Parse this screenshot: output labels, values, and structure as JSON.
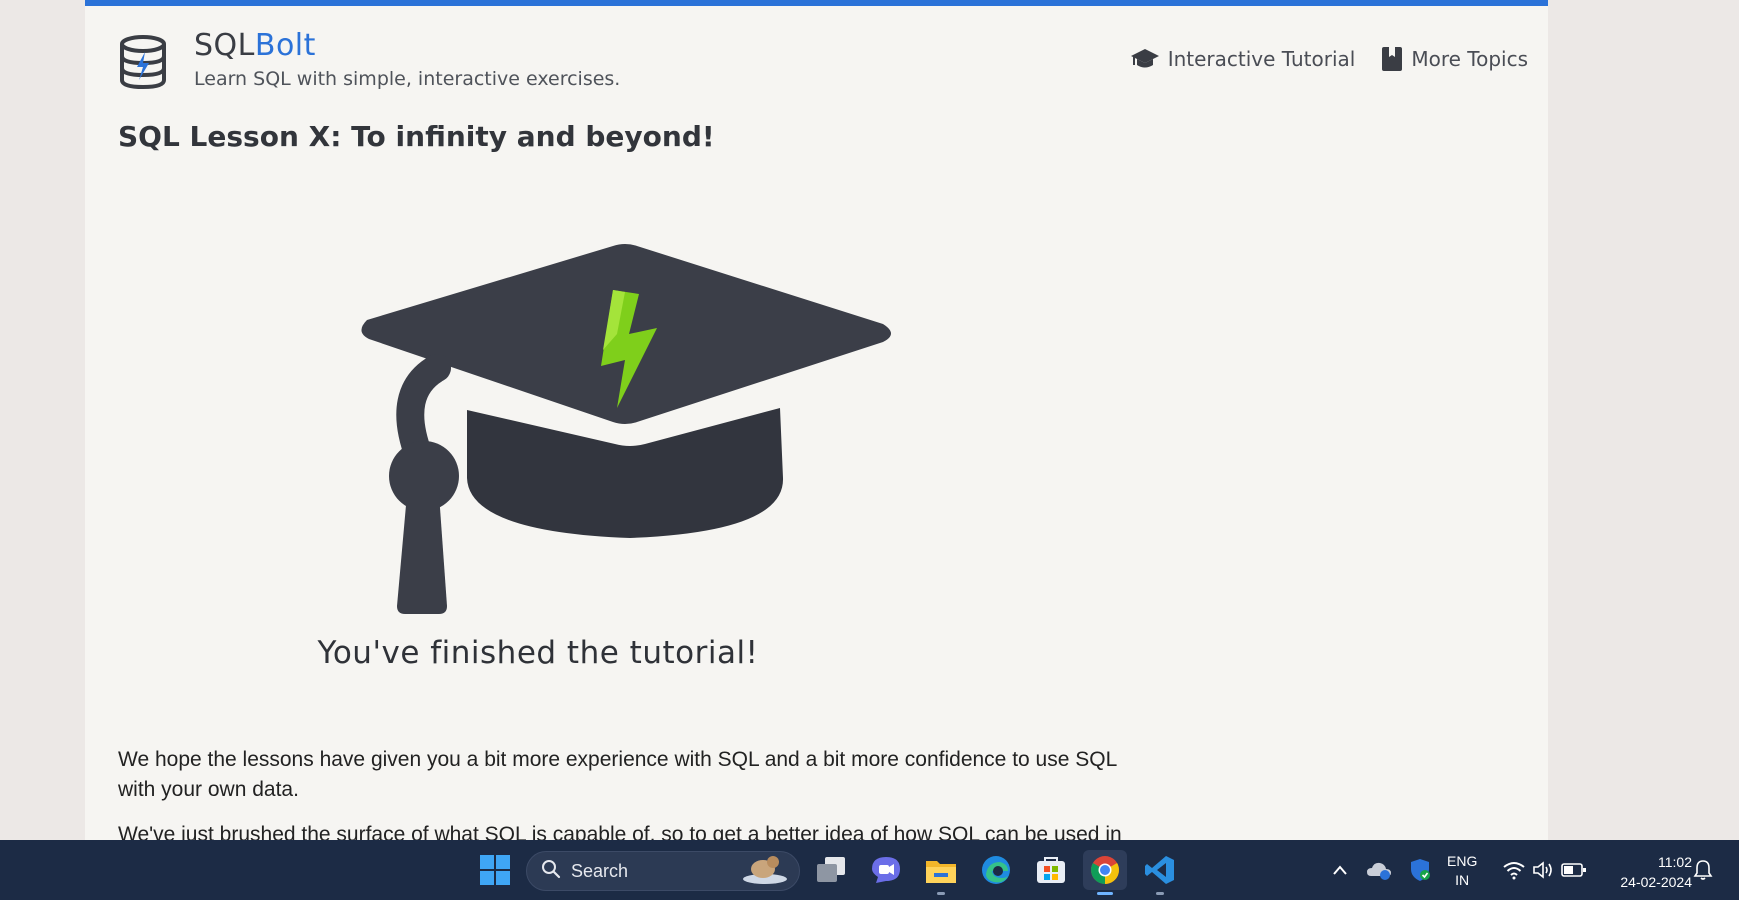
{
  "colors": {
    "accent": "#2b72d8",
    "page_bg": "#f6f5f2",
    "hat": "#393c46",
    "bolt": "#7fcf1b",
    "taskbar": "#1c2b45"
  },
  "header": {
    "brand_part1": "SQL",
    "brand_part2": "Bolt",
    "tagline": "Learn SQL with simple, interactive exercises.",
    "logo_icon": "database-bolt-icon",
    "nav": [
      {
        "label": "Interactive Tutorial",
        "icon": "graduation-cap-icon"
      },
      {
        "label": "More Topics",
        "icon": "book-icon"
      }
    ]
  },
  "main": {
    "lesson_title": "SQL Lesson X: To infinity and beyond!",
    "hero_icon": "graduation-cap-bolt-icon",
    "finished_text": "You've finished the tutorial!",
    "paragraph1": "We hope the lessons have given you a bit more experience with SQL and a bit more confidence to use SQL with your own data.",
    "paragraph2": "We've just brushed the surface of what SQL is capable of, so to get a better idea of how SQL can be used in"
  },
  "taskbar": {
    "search_placeholder": "Search",
    "apps": [
      "windows-start-icon",
      "task-view-icon",
      "chat-icon",
      "file-explorer-icon",
      "edge-icon",
      "store-icon",
      "chrome-icon",
      "vscode-icon"
    ],
    "lang_line1": "ENG",
    "lang_line2": "IN",
    "time": "11:02",
    "date": "24-02-2024"
  }
}
